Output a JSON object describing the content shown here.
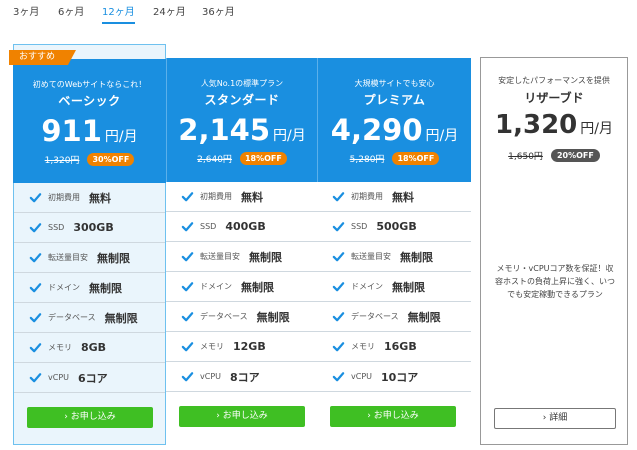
{
  "tabs": [
    "3ヶ月",
    "6ヶ月",
    "12ヶ月",
    "24ヶ月",
    "36ヶ月"
  ],
  "active_tab": "12ヶ月",
  "colors": {
    "accent": "#1a8fe0",
    "badge": "#f08200",
    "cta": "#3fbf23"
  },
  "feature_labels": {
    "initial": "初期費用",
    "ssd": "SSD",
    "transfer": "転送量目安",
    "domain": "ドメイン",
    "database": "データベース",
    "memory": "メモリ",
    "vcpu": "vCPU"
  },
  "plans": [
    {
      "badge": "おすすめ",
      "tagline": "初めてのWebサイトならこれ！",
      "name": "ベーシック",
      "price": "911",
      "unit": "円/月",
      "old_price": "1,320円",
      "discount": "30%OFF",
      "features": {
        "initial": "無料",
        "ssd": "300GB",
        "transfer": "無制限",
        "domain": "無制限",
        "database": "無制限",
        "memory": "8GB",
        "vcpu": "6コア"
      },
      "cta": "お申し込み"
    },
    {
      "tagline": "人気No.1の標準プラン",
      "name": "スタンダード",
      "price": "2,145",
      "unit": "円/月",
      "old_price": "2,640円",
      "discount": "18%OFF",
      "features": {
        "initial": "無料",
        "ssd": "400GB",
        "transfer": "無制限",
        "domain": "無制限",
        "database": "無制限",
        "memory": "12GB",
        "vcpu": "8コア"
      },
      "cta": "お申し込み"
    },
    {
      "tagline": "大規模サイトでも安心",
      "name": "プレミアム",
      "price": "4,290",
      "unit": "円/月",
      "old_price": "5,280円",
      "discount": "18%OFF",
      "features": {
        "initial": "無料",
        "ssd": "500GB",
        "transfer": "無制限",
        "domain": "無制限",
        "database": "無制限",
        "memory": "16GB",
        "vcpu": "10コア"
      },
      "cta": "お申し込み"
    }
  ],
  "reserved": {
    "tagline": "安定したパフォーマンスを提供",
    "name": "リザーブド",
    "price": "1,320",
    "unit": "円/月",
    "old_price": "1,650円",
    "discount": "20%OFF",
    "description": "メモリ・vCPUコア数を保証！収容ホストの負荷上昇に強く、いつでも安定稼動できるプラン",
    "cta": "詳細"
  }
}
